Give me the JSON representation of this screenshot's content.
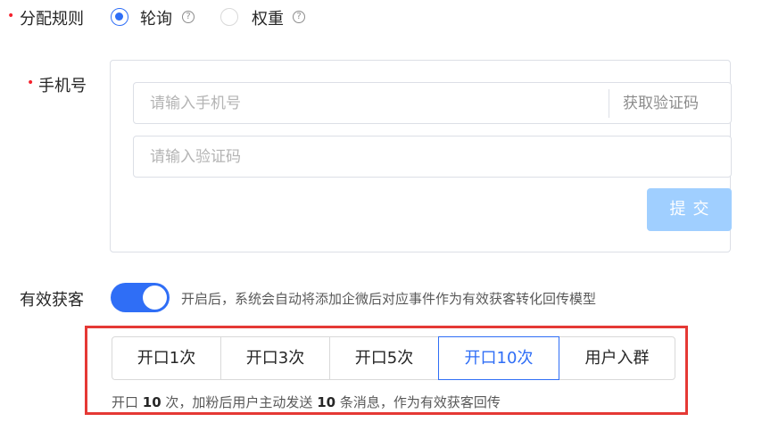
{
  "distribution": {
    "label": "分配规则",
    "options": [
      {
        "label": "轮询",
        "checked": true
      },
      {
        "label": "权重",
        "checked": false
      }
    ],
    "help_glyph": "?"
  },
  "phone": {
    "label": "手机号",
    "phone_placeholder": "请输入手机号",
    "get_code_label": "获取验证码",
    "code_placeholder": "请输入验证码",
    "submit_label": "提交"
  },
  "valid_lead": {
    "label": "有效获客",
    "enabled": true,
    "hint": "开启后，系统会自动将添加企微后对应事件作为有效获客转化回传模型"
  },
  "segments": {
    "items": [
      "开口1次",
      "开口3次",
      "开口5次",
      "开口10次",
      "用户入群"
    ],
    "active_index": 3,
    "note": {
      "p1": "开口 ",
      "n1": "10",
      "p2": " 次，加粉后用户主动发送 ",
      "n2": "10",
      "p3": " 条消息，作为有效获客回传"
    }
  },
  "colors": {
    "primary": "#2f6ef6",
    "required": "#f5222d",
    "submit_disabled": "#a0cfff",
    "highlight": "#e53935"
  }
}
